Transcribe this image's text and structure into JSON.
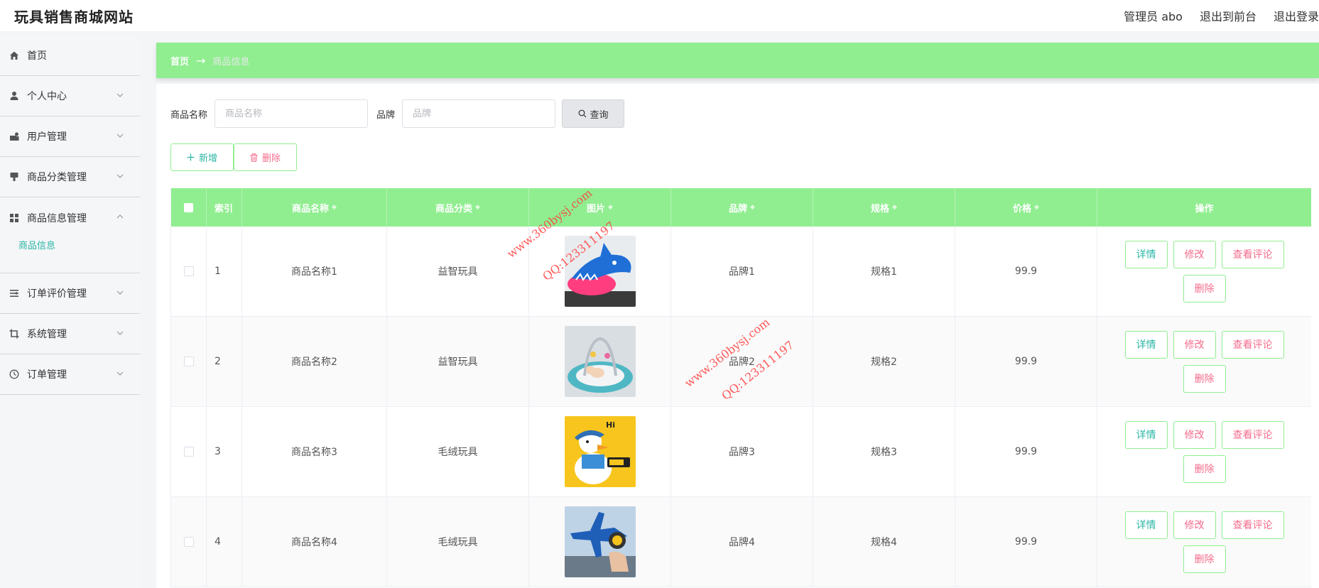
{
  "app": {
    "title": "玩具销售商城网站"
  },
  "header": {
    "admin_label": "管理员 abo",
    "to_front_label": "退出到前台",
    "logout_label": "退出登录"
  },
  "sidebar": {
    "items": [
      {
        "label": "首页",
        "icon": "home-icon",
        "expandable": false
      },
      {
        "label": "个人中心",
        "icon": "user-icon",
        "expandable": true
      },
      {
        "label": "用户管理",
        "icon": "users-icon",
        "expandable": true
      },
      {
        "label": "商品分类管理",
        "icon": "category-icon",
        "expandable": true
      },
      {
        "label": "商品信息管理",
        "icon": "grid-icon",
        "expandable": true,
        "open": true,
        "children": [
          {
            "label": "商品信息"
          }
        ]
      },
      {
        "label": "订单评价管理",
        "icon": "list-icon",
        "expandable": true
      },
      {
        "label": "系统管理",
        "icon": "crop-icon",
        "expandable": true
      },
      {
        "label": "订单管理",
        "icon": "clock-icon",
        "expandable": true
      }
    ]
  },
  "breadcrumb": {
    "home": "首页",
    "separator": "→",
    "current": "商品信息"
  },
  "search": {
    "name_label": "商品名称",
    "name_placeholder": "商品名称",
    "name_value": "",
    "brand_label": "品牌",
    "brand_placeholder": "品牌",
    "brand_value": "",
    "query_button": "查询"
  },
  "actions": {
    "add_label": "新增",
    "delete_label": "删除"
  },
  "table": {
    "columns": [
      "索引",
      "商品名称",
      "商品分类",
      "图片",
      "品牌",
      "规格",
      "价格",
      "操作"
    ],
    "rows": [
      {
        "index": "1",
        "name": "商品名称1",
        "category": "益智玩具",
        "image": "shark-toy",
        "brand": "品牌1",
        "spec": "规格1",
        "price": "99.9"
      },
      {
        "index": "2",
        "name": "商品名称2",
        "category": "益智玩具",
        "image": "baby-gym-mat",
        "brand": "品牌2",
        "spec": "规格2",
        "price": "99.9"
      },
      {
        "index": "3",
        "name": "商品名称3",
        "category": "毛绒玩具",
        "image": "plush-duck",
        "brand": "品牌3",
        "spec": "规格3",
        "price": "99.9"
      },
      {
        "index": "4",
        "name": "商品名称4",
        "category": "毛绒玩具",
        "image": "toy-airplane",
        "brand": "品牌4",
        "spec": "规格4",
        "price": "99.9"
      }
    ],
    "row_ops": {
      "detail": "详情",
      "edit": "修改",
      "review": "查看评论",
      "delete": "删除"
    }
  },
  "watermark": {
    "site": "www.360bysj.com",
    "qq": "QQ:123311197"
  },
  "colors": {
    "accent_green": "#90ee90",
    "teal_text": "#2ab6a6",
    "pink_text": "#f56c8c",
    "watermark_red": "#ff3b3b"
  }
}
